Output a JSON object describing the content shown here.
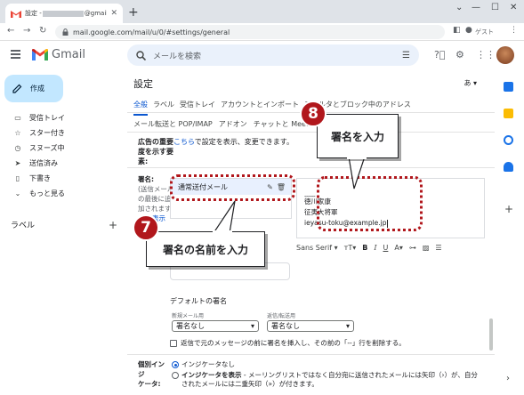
{
  "browser": {
    "tab_title_prefix": "設定 -",
    "tab_title_suffix": "@gmail.com",
    "url": "mail.google.com/mail/u/0/#settings/general",
    "guest_label": "ゲスト"
  },
  "header": {
    "app_name": "Gmail",
    "search_placeholder": "メールを検索"
  },
  "sidebar": {
    "compose_label": "作成",
    "items": [
      {
        "label": "受信トレイ",
        "icon": "inbox-icon"
      },
      {
        "label": "スター付き",
        "icon": "star-icon"
      },
      {
        "label": "スヌーズ中",
        "icon": "clock-icon"
      },
      {
        "label": "送信済み",
        "icon": "send-icon"
      },
      {
        "label": "下書き",
        "icon": "draft-icon"
      },
      {
        "label": "もっと見る",
        "icon": "chevron-down-icon"
      }
    ],
    "labels_heading": "ラベル"
  },
  "settings": {
    "title": "設定",
    "language_button": "あ",
    "tabs_row1": [
      "全般",
      "ラベル",
      "受信トレイ",
      "アカウントとインポート",
      "フィルタとブロック中のアドレス"
    ],
    "tabs_row2": [
      "メール転送と POP/IMAP",
      "アドオン",
      "チャットと Meet"
    ],
    "images": {
      "label_line1": "広告の重要",
      "link": "こちら",
      "text": "で設定を表示、変更できます。",
      "label_line2": "度を示す要",
      "label_line3": "素:"
    },
    "signature": {
      "label": "署名:",
      "desc1": "(送信メール",
      "desc2": "の最後に追",
      "desc3": "加されます)",
      "more_link": "表示",
      "list_item": "通常送付メール",
      "editor_separator": "------",
      "editor_lines": [
        "徳川家康",
        "征夷大将軍",
        "ieyasu-toku@example.jp"
      ],
      "font_name": "Sans Serif"
    },
    "defaults": {
      "title": "デフォルトの署名",
      "new_label": "新規メール用",
      "new_value": "署名なし",
      "reply_label": "返信/転送用",
      "reply_value": "署名なし",
      "checkbox_text": "返信で元のメッセージの前に署名を挿入し、その前の「--」行を削除する。"
    },
    "indicator": {
      "label_line1": "個別インジ",
      "label_line2": "ケータ:",
      "opt1": "インジケータなし",
      "opt2_bold": "インジケータを表示",
      "opt2_text": " - メーリングリストではなく自分宛に送信されたメールには矢印（›）が、自分",
      "opt2_line2": "されたメールには二重矢印（»）が付きます。"
    }
  },
  "callouts": {
    "callout7_number": "7",
    "callout7_text": "署名の名前を入力",
    "callout8_number": "8",
    "callout8_text": "署名を入力"
  },
  "colors": {
    "accent": "#0b57d0",
    "compose_bg": "#c2e7ff",
    "callout_red": "#b1171c"
  }
}
